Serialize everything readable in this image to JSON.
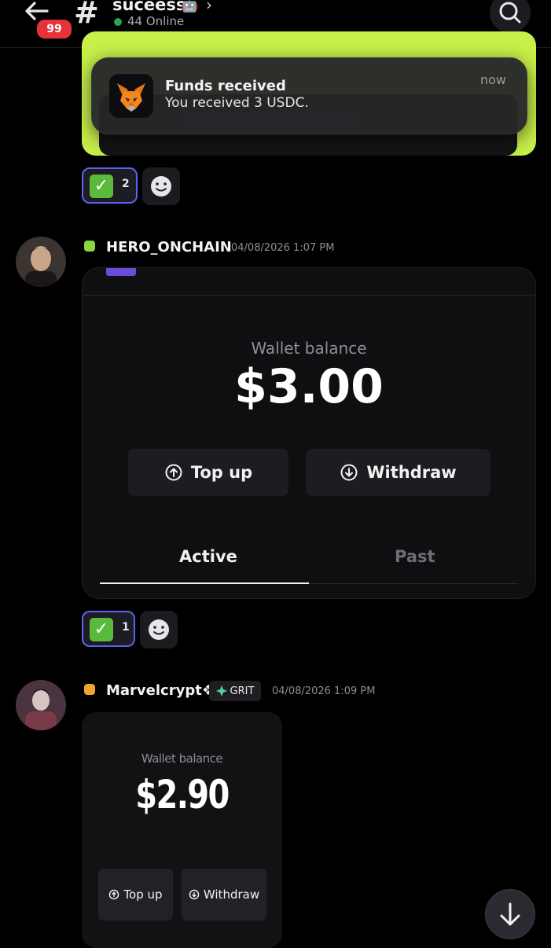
{
  "header": {
    "unread_badge": "99",
    "channel_symbol": "#",
    "channel_name": "suceess-",
    "channel_emoji": "🤖",
    "chevron": "›",
    "online_text": "44 Online"
  },
  "notification": {
    "title": "Funds received",
    "message": "You received 3 USDC.",
    "time": "now",
    "icon": "metamask-fox-icon"
  },
  "reactions_1": {
    "emoji": "✓",
    "count": "2"
  },
  "message_1": {
    "username": "HERO_ONCHAIN",
    "timestamp": "04/08/2026 1:07 PM",
    "status_color": "#8bd33f",
    "wallet": {
      "label": "Wallet balance",
      "amount": "$3.00",
      "top_up": "Top up",
      "withdraw": "Withdraw",
      "tabs": [
        {
          "label": "Active",
          "selected": true
        },
        {
          "label": "Past",
          "selected": false
        }
      ]
    }
  },
  "reactions_2": {
    "emoji": "✓",
    "count": "1"
  },
  "message_2": {
    "username": "Marvelcrypt❖",
    "tag": "GRIT",
    "timestamp": "04/08/2026 1:09 PM",
    "status_color": "#f0a232",
    "wallet": {
      "label": "Wallet balance",
      "amount": "$2.90",
      "top_up": "Top up",
      "withdraw": "Withdraw"
    }
  },
  "colors": {
    "accent": "#5865f2",
    "embed_green": "#c8f04a",
    "badge_red": "#e5323b",
    "online_green": "#23a55a"
  }
}
